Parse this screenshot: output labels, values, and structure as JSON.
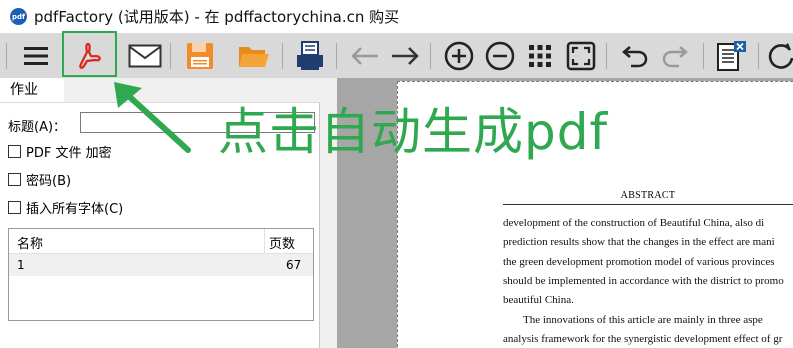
{
  "window": {
    "app_icon_text": "pdf",
    "title": "pdfFactory (试用版本) - 在 pdffactorychina.cn 购买"
  },
  "toolbar": {
    "buttons": [
      {
        "name": "menu-icon"
      },
      {
        "name": "acrobat-pdf-icon"
      },
      {
        "name": "email-icon"
      },
      {
        "name": "save-icon"
      },
      {
        "name": "open-folder-icon"
      },
      {
        "name": "print-icon"
      },
      {
        "name": "back-arrow-icon"
      },
      {
        "name": "forward-arrow-icon"
      },
      {
        "name": "zoom-in-icon"
      },
      {
        "name": "zoom-out-icon"
      },
      {
        "name": "thumbnails-grid-icon"
      },
      {
        "name": "fit-page-icon"
      },
      {
        "name": "undo-icon"
      },
      {
        "name": "redo-icon"
      },
      {
        "name": "document-remove-icon"
      },
      {
        "name": "refresh-icon"
      }
    ]
  },
  "left_panel": {
    "tab_label": "作业",
    "title_label": "标题(A)：",
    "title_value": "",
    "checkboxes": [
      {
        "label": "PDF 文件 加密",
        "checked": false
      },
      {
        "label": "密码(B)",
        "checked": false
      },
      {
        "label": "插入所有字体(C)",
        "checked": false
      }
    ],
    "list": {
      "col_name": "名称",
      "col_pages": "页数",
      "rows": [
        {
          "name": "1",
          "pages": "67"
        }
      ]
    }
  },
  "preview": {
    "abstract_heading": "ABSTRACT",
    "lines": [
      "development of the construction of Beautiful China, also di",
      "prediction results show that the changes in the effect are mani",
      "the green development promotion model of various provinces",
      "should be implemented in accordance with the district to promo",
      "beautiful China.",
      "The innovations of this article are mainly in three aspe",
      "analysis framework for the synergistic development effect of gr"
    ]
  },
  "annotation": {
    "text": "点击自动生成pdf",
    "color": "#2fa84f"
  }
}
